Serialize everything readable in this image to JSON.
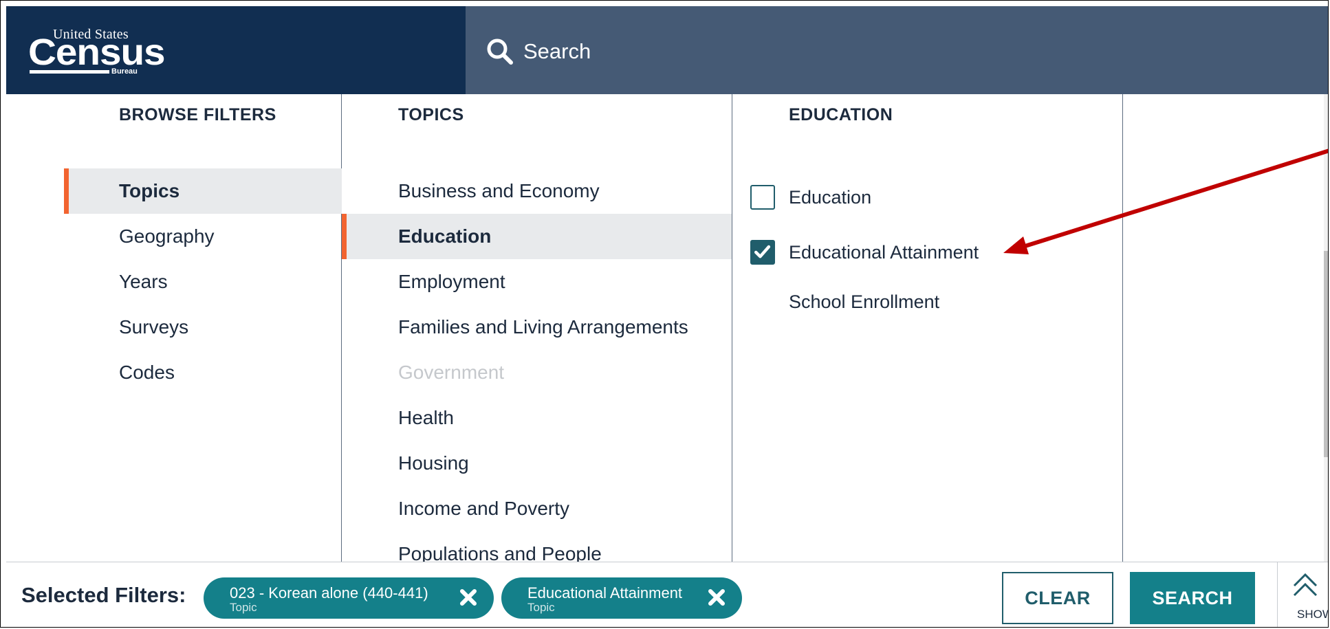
{
  "header": {
    "logo": {
      "top": "United States",
      "main": "Census",
      "bottom": "Bureau"
    },
    "search_placeholder": "Search"
  },
  "browse_filters": {
    "heading": "BROWSE FILTERS",
    "items": [
      {
        "label": "Topics",
        "active": true
      },
      {
        "label": "Geography"
      },
      {
        "label": "Years"
      },
      {
        "label": "Surveys"
      },
      {
        "label": "Codes"
      }
    ]
  },
  "topics": {
    "heading": "TOPICS",
    "items": [
      {
        "label": "Business and Economy"
      },
      {
        "label": "Education",
        "active": true
      },
      {
        "label": "Employment"
      },
      {
        "label": "Families and Living Arrangements"
      },
      {
        "label": "Government",
        "disabled": true
      },
      {
        "label": "Health"
      },
      {
        "label": "Housing"
      },
      {
        "label": "Income and Poverty"
      },
      {
        "label": "Populations and People"
      }
    ]
  },
  "education": {
    "heading": "EDUCATION",
    "items": [
      {
        "label": "Education",
        "checked": false
      },
      {
        "label": "Educational Attainment",
        "checked": true
      },
      {
        "label": "School Enrollment"
      }
    ]
  },
  "bottom_bar": {
    "selected_label": "Selected Filters:",
    "chips": [
      {
        "title": "023 - Korean alone (440-441)",
        "subtitle": "Topic"
      },
      {
        "title": "Educational Attainment",
        "subtitle": "Topic"
      }
    ],
    "clear_label": "CLEAR",
    "search_label": "SEARCH",
    "show_label": "SHOW"
  },
  "colors": {
    "header_dark": "#112e51",
    "header_search": "#455a75",
    "accent": "#f26430",
    "teal": "#14808a",
    "annotation": "#c00000"
  }
}
